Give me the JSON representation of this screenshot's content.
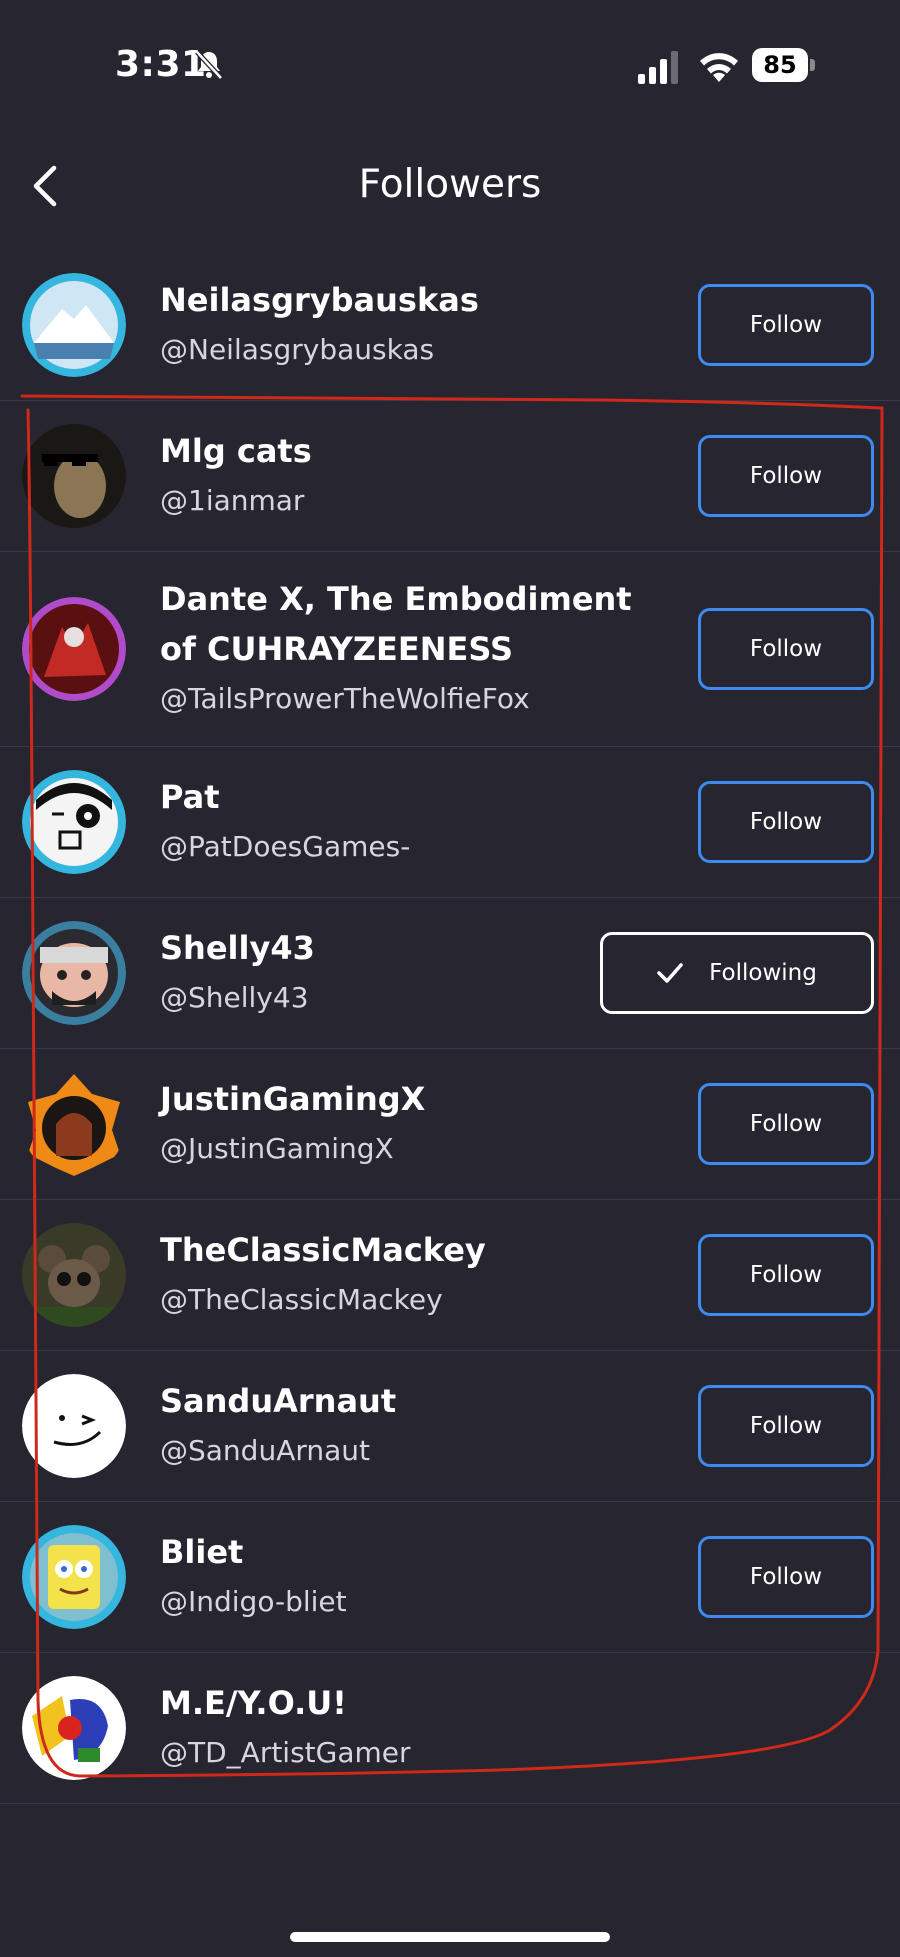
{
  "status_bar": {
    "time": "3:31",
    "battery": "85",
    "icons": [
      "bell-slash-icon",
      "signal-icon",
      "wifi-icon",
      "battery-icon"
    ]
  },
  "header": {
    "title": "Followers",
    "back_icon": "chevron-left-icon"
  },
  "colors": {
    "background": "#262530",
    "follow_border": "#3d8bef",
    "annotation": "#d0281b"
  },
  "followers": [
    {
      "name": "Neilasgrybauskas",
      "handle": "@Neilasgrybauskas",
      "button": "Follow"
    },
    {
      "name": "Mlg cats",
      "handle": "@1ianmar",
      "button": "Follow"
    },
    {
      "name": "Dante X, The Embodiment of CUHRAYZEENESS",
      "handle": "@TailsProwerTheWolfieFox",
      "button": "Follow"
    },
    {
      "name": "Pat",
      "handle": "@PatDoesGames-",
      "button": "Follow"
    },
    {
      "name": "Shelly43",
      "handle": "@Shelly43",
      "button": "Following"
    },
    {
      "name": "JustinGamingX",
      "handle": "@JustinGamingX",
      "button": "Follow"
    },
    {
      "name": "TheClassicMackey",
      "handle": "@TheClassicMackey",
      "button": "Follow"
    },
    {
      "name": "SanduArnaut",
      "handle": "@SanduArnaut",
      "button": "Follow"
    },
    {
      "name": "Bliet",
      "handle": "@Indigo-bliet",
      "button": "Follow"
    },
    {
      "name": "M.E/Y.O.U!",
      "handle": "@TD_ArtistGamer",
      "button": ""
    }
  ]
}
